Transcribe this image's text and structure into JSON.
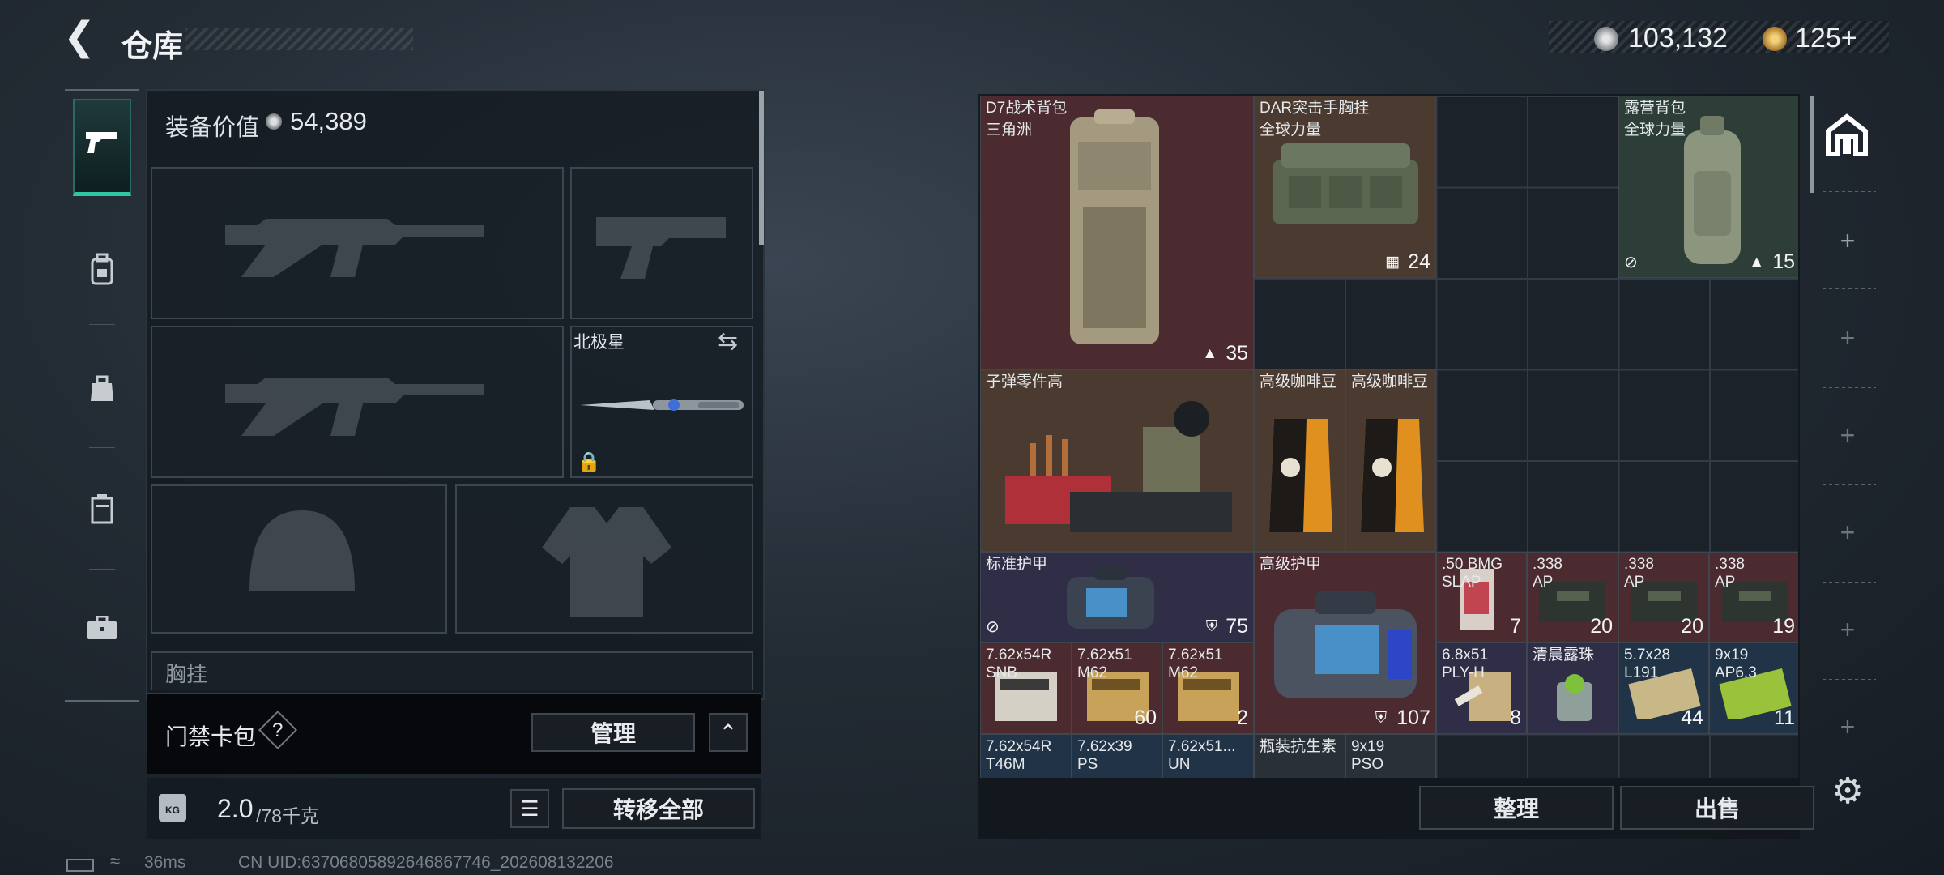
{
  "header": {
    "title": "仓库"
  },
  "currency": {
    "silver": "103,132",
    "gold": "125+"
  },
  "tabs": [
    {
      "icon": "pistol-icon",
      "active": true
    },
    {
      "icon": "backpack-icon"
    },
    {
      "icon": "pouch-icon"
    },
    {
      "icon": "locker-icon"
    },
    {
      "icon": "briefcase-icon"
    }
  ],
  "loadout": {
    "equip_value_label": "装备价值",
    "equip_value": "54,389",
    "melee_name": "北极星",
    "next_section_label": "胸挂"
  },
  "keycard": {
    "label": "门禁卡包",
    "help": "?",
    "manage_label": "管理"
  },
  "weight": {
    "current": "2.0",
    "max": "/78千克",
    "transfer_label": "转移全部",
    "icon_text": "KG"
  },
  "status": {
    "ping": "36ms",
    "uid": "CN UID:6370680589264686​7746_202608132206"
  },
  "stash": {
    "items": [
      {
        "name": "D7战术背包",
        "sub": "三角洲",
        "count": "35",
        "count_icon": "backpack-icon"
      },
      {
        "name": "DAR突击手胸挂",
        "sub": "全球力量",
        "count": "24",
        "count_icon": "vest-icon"
      },
      {
        "name": "露营背包",
        "sub": "全球力量",
        "count": "15",
        "count_icon": "backpack-icon",
        "banned": true
      },
      {
        "name": "子弹零件高"
      },
      {
        "name": "高级咖啡豆"
      },
      {
        "name": "高级咖啡豆"
      },
      {
        "name": "标准护甲",
        "count": "75",
        "count_icon": "shield-icon",
        "banned": true
      },
      {
        "name": "高级护甲",
        "count": "107",
        "count_icon": "shield-icon"
      },
      {
        "name": ".50 BMG",
        "sub": "SLAP",
        "count": "7"
      },
      {
        "name": ".338",
        "sub": "AP",
        "count": "20"
      },
      {
        "name": ".338",
        "sub": "AP",
        "count": "20"
      },
      {
        "name": ".338",
        "sub": "AP",
        "count": "19"
      },
      {
        "name": "7.62x54R",
        "sub": "SNB"
      },
      {
        "name": "7.62x51",
        "sub": "M62",
        "count": "60"
      },
      {
        "name": "7.62x51",
        "sub": "M62",
        "count": "2"
      },
      {
        "name": "6.8x51",
        "sub": "PLY-H",
        "count": "8"
      },
      {
        "name": "清晨露珠"
      },
      {
        "name": "5.7x28",
        "sub": "L191",
        "count": "44"
      },
      {
        "name": "9x19",
        "sub": "AP6.3",
        "count": "11"
      },
      {
        "name": "7.62x54R",
        "sub": "T46M"
      },
      {
        "name": "7.62x39",
        "sub": "PS"
      },
      {
        "name": "7.62x51...",
        "sub": "UN"
      },
      {
        "name": "瓶装抗生素"
      },
      {
        "name": "9x19",
        "sub": "PSO"
      }
    ],
    "sort_label": "整理",
    "sell_label": "出售"
  },
  "colors": {
    "accent": "#2fc7a6",
    "rarity_red": "#4b2a30",
    "rarity_gold": "#4a3a30",
    "rarity_green": "#2c3e37",
    "rarity_purple": "#2f2e46",
    "rarity_blue": "#213346"
  }
}
